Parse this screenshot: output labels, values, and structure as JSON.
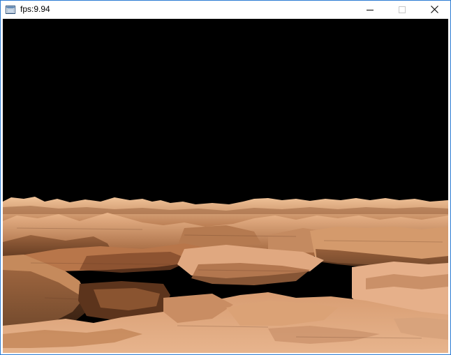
{
  "window": {
    "title": "fps:9.94",
    "icon": "app-window-icon",
    "controls": [
      {
        "name": "minimize",
        "icon": "minimize-icon"
      },
      {
        "name": "maximize",
        "icon": "maximize-icon",
        "disabled": true
      },
      {
        "name": "close",
        "icon": "close-icon"
      }
    ]
  },
  "scene": {
    "description_colors": {
      "sky": "#000000",
      "terrain_light": "#e7b488",
      "terrain_mid": "#c88b5f",
      "terrain_dark": "#6e4226"
    }
  }
}
